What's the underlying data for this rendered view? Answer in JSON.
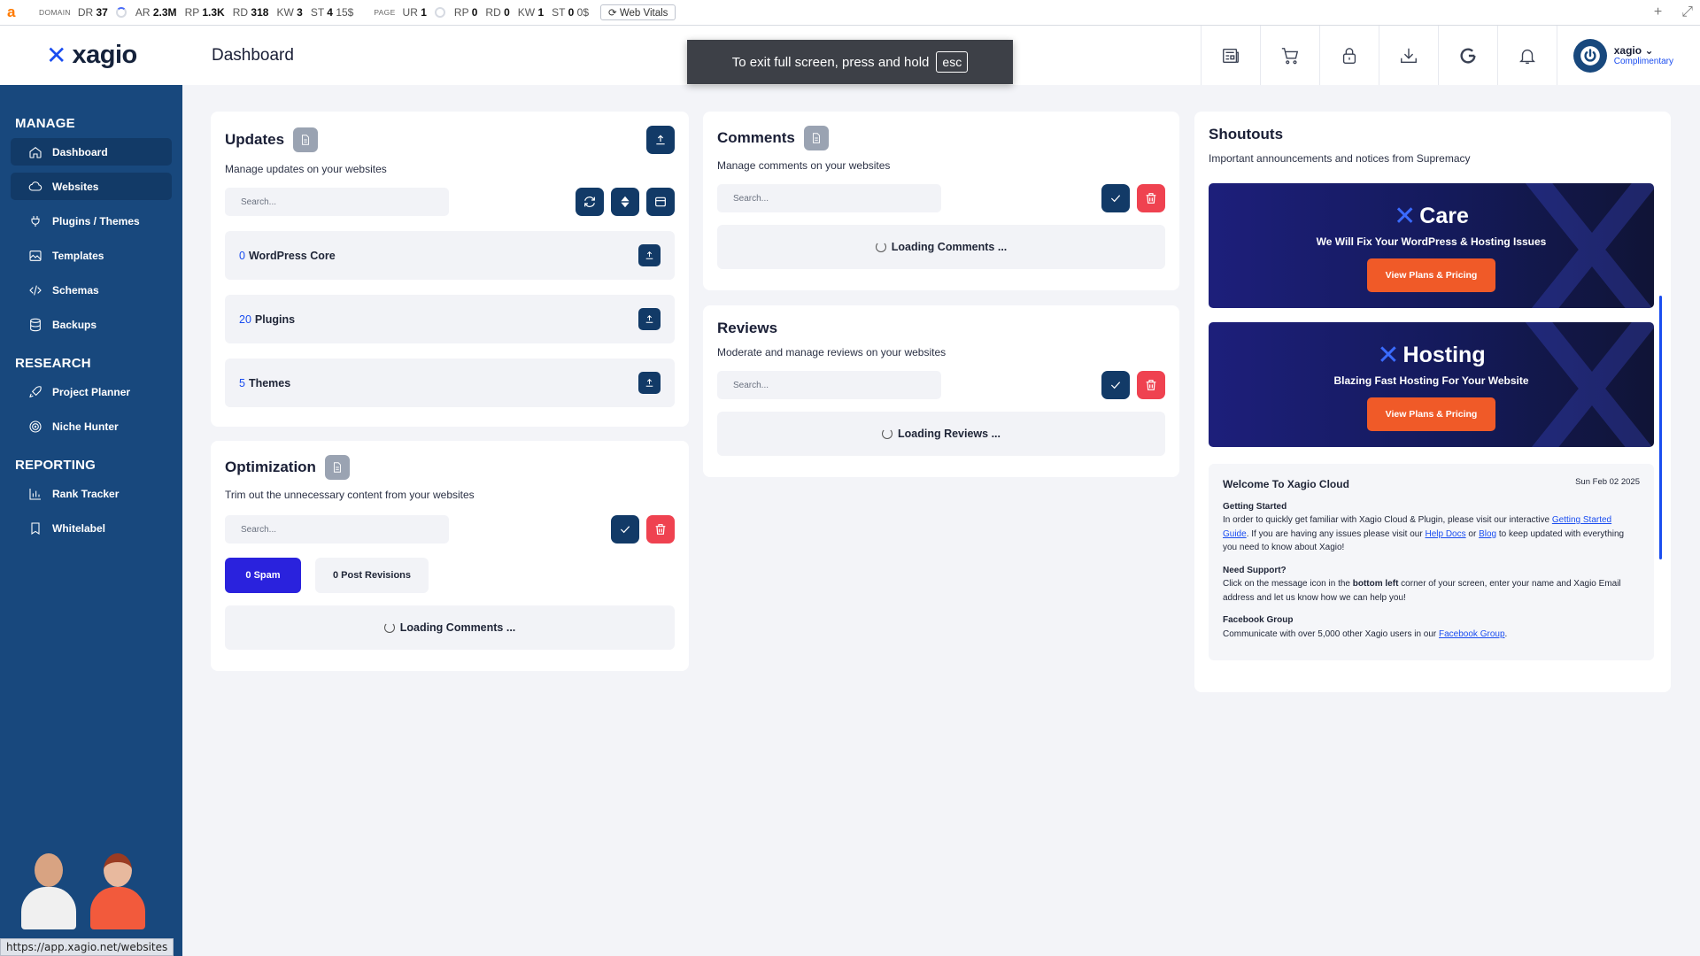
{
  "ext_bar": {
    "logo": "a",
    "domain_tag": "DOMAIN",
    "page_tag": "PAGE",
    "domain_stats": [
      {
        "k": "DR",
        "v": "37"
      },
      {
        "k": "AR",
        "v": "2.3M"
      },
      {
        "k": "RP",
        "v": "1.3K"
      },
      {
        "k": "RD",
        "v": "318"
      },
      {
        "k": "KW",
        "v": "3"
      },
      {
        "k": "ST",
        "v": "4"
      },
      {
        "k": "",
        "v": "15$"
      }
    ],
    "page_stats": [
      {
        "k": "UR",
        "v": "1"
      },
      {
        "k": "RP",
        "v": "0"
      },
      {
        "k": "RD",
        "v": "0"
      },
      {
        "k": "KW",
        "v": "1"
      },
      {
        "k": "ST",
        "v": "0"
      },
      {
        "k": "",
        "v": "0$"
      }
    ],
    "web_vitals": "Web Vitals",
    "plus": "+",
    "expand": "⤢"
  },
  "brand": {
    "mark": "✕",
    "name": "xagio"
  },
  "header": {
    "title": "Dashboard",
    "user_name": "xagio",
    "user_plan": "Complimentary",
    "icons": [
      "news-icon",
      "cart-icon",
      "lock-icon",
      "download-icon",
      "google-icon",
      "bell-icon"
    ]
  },
  "fullscreen_toast": {
    "text": "To exit full screen, press and hold",
    "key": "esc"
  },
  "sidebar": {
    "sections": [
      {
        "title": "MANAGE",
        "items": [
          {
            "label": "Dashboard",
            "icon": "home-icon",
            "active": true
          },
          {
            "label": "Websites",
            "icon": "cloud-icon",
            "active": true
          },
          {
            "label": "Plugins / Themes",
            "icon": "plug-icon"
          },
          {
            "label": "Templates",
            "icon": "image-icon"
          },
          {
            "label": "Schemas",
            "icon": "code-icon"
          },
          {
            "label": "Backups",
            "icon": "database-icon"
          }
        ]
      },
      {
        "title": "RESEARCH",
        "items": [
          {
            "label": "Project Planner",
            "icon": "rocket-icon"
          },
          {
            "label": "Niche Hunter",
            "icon": "target-icon"
          }
        ]
      },
      {
        "title": "REPORTING",
        "items": [
          {
            "label": "Rank Tracker",
            "icon": "bar-chart-icon"
          },
          {
            "label": "Whitelabel",
            "icon": "bookmark-icon"
          }
        ]
      }
    ],
    "status_url": "https://app.xagio.net/websites"
  },
  "updates": {
    "title": "Updates",
    "subtitle": "Manage updates on your websites",
    "search_placeholder": "Search...",
    "items": [
      {
        "count": "0",
        "label": "WordPress Core"
      },
      {
        "count": "20",
        "label": "Plugins"
      },
      {
        "count": "5",
        "label": "Themes"
      }
    ]
  },
  "optimization": {
    "title": "Optimization",
    "subtitle": "Trim out the unnecessary content from your websites",
    "search_placeholder": "Search...",
    "spam_label": "0 Spam",
    "revisions_label": "0 Post Revisions",
    "loading": "Loading Comments ..."
  },
  "comments": {
    "title": "Comments",
    "subtitle": "Manage comments on your websites",
    "search_placeholder": "Search...",
    "loading": "Loading Comments ..."
  },
  "reviews": {
    "title": "Reviews",
    "subtitle": "Moderate and manage reviews on your websites",
    "search_placeholder": "Search...",
    "loading": "Loading Reviews ..."
  },
  "shoutouts": {
    "title": "Shoutouts",
    "subtitle": "Important announcements and notices from Supremacy",
    "promos": [
      {
        "brand": "Care",
        "tagline": "We Will Fix Your WordPress & Hosting Issues",
        "button": "View Plans & Pricing"
      },
      {
        "brand": "Hosting",
        "tagline": "Blazing Fast Hosting For Your Website",
        "button": "View Plans & Pricing"
      }
    ],
    "welcome": {
      "title": "Welcome To Xagio Cloud",
      "date": "Sun Feb 02 2025",
      "s1_title": "Getting Started",
      "s1_a": "In order to quickly get familiar with Xagio Cloud & Plugin, please visit our interactive ",
      "s1_link1": "Getting Started Guide",
      "s1_b": ".  If you are having any issues please visit our ",
      "s1_link2": "Help Docs",
      "s1_c": " or ",
      "s1_link3": "Blog",
      "s1_d": " to keep updated with everything you need to know about Xagio!",
      "s2_title": "Need Support?",
      "s2_a": "Click on the message icon in the ",
      "s2_bold": "bottom left",
      "s2_b": " corner of your screen, enter your name and Xagio Email address and let us know how we can help you!",
      "s3_title": "Facebook Group",
      "s3_a": "Communicate with over 5,000 other Xagio users in our ",
      "s3_link": "Facebook Group",
      "s3_b": "."
    }
  },
  "colors": {
    "sidebar": "#18487d",
    "accent": "#1a4df0",
    "danger": "#ef4250",
    "dark_btn": "#123a67",
    "promo_btn": "#f05a28"
  }
}
